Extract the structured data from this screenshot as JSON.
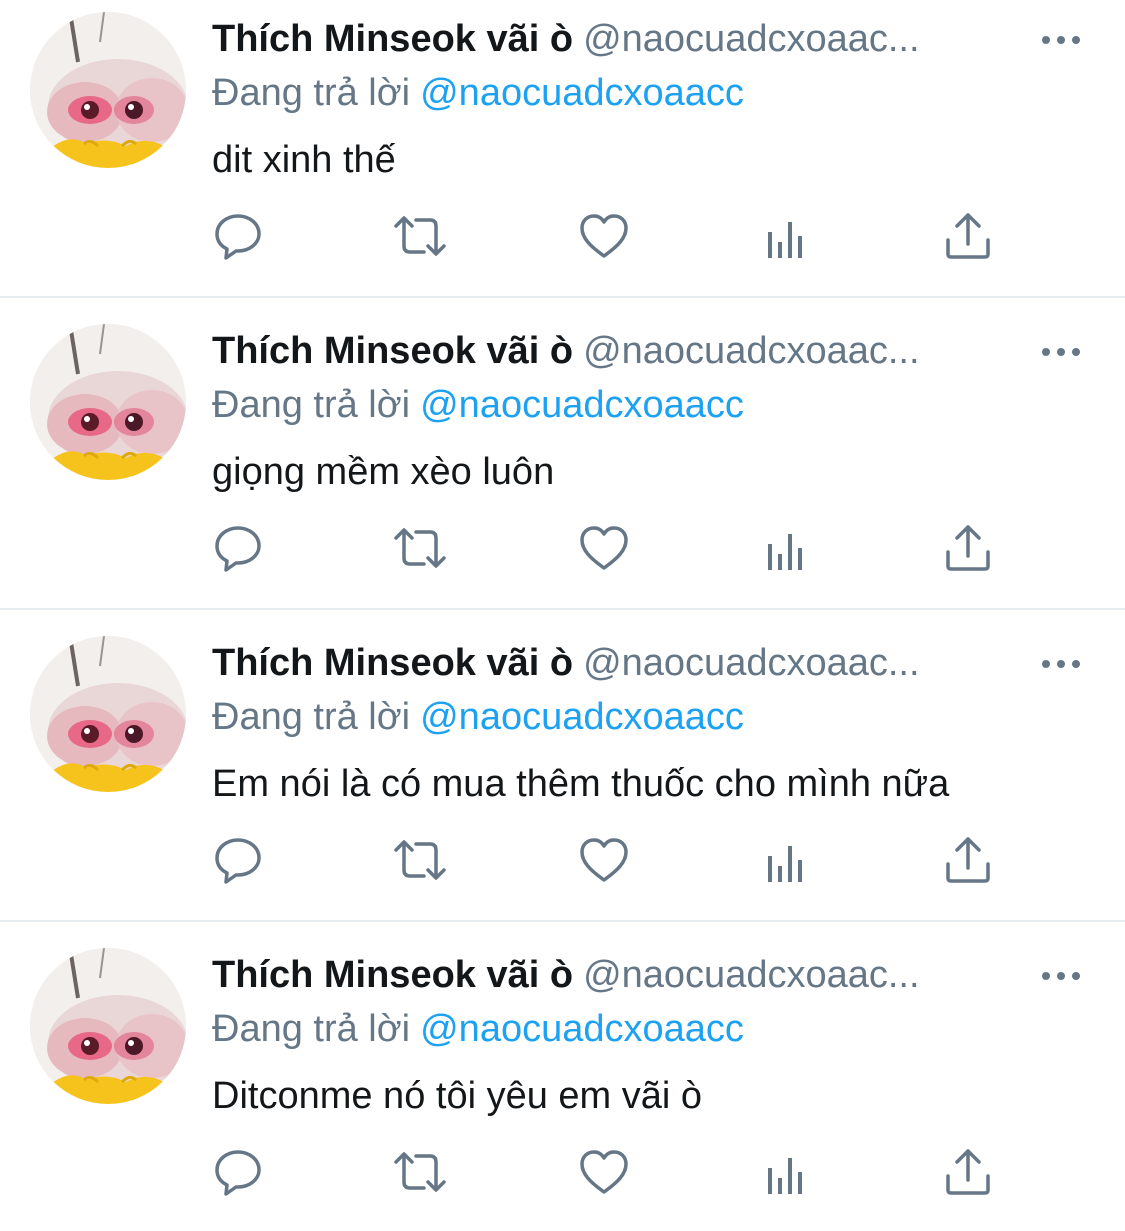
{
  "colors": {
    "name": "#14171a",
    "secondary": "#657786",
    "link": "#1da1f2",
    "divider": "#e6ecf0",
    "icon": "#657786"
  },
  "icons": {
    "reply": "speech-bubble-icon",
    "retweet": "retweet-arrows-icon",
    "like": "heart-icon",
    "analytics": "bar-chart-icon",
    "share": "share-upload-icon",
    "more": "ellipsis-icon"
  },
  "tweets": [
    {
      "display_name": "Thích Minseok vãi ò",
      "handle": "@naocuadcxoaac...",
      "reply_prefix": "Đang trả lời",
      "reply_to": "@naocuadcxoaacc",
      "text": "dit xinh thế"
    },
    {
      "display_name": "Thích Minseok vãi ò",
      "handle": "@naocuadcxoaac...",
      "reply_prefix": "Đang trả lời",
      "reply_to": "@naocuadcxoaacc",
      "text": "giọng mềm xèo luôn"
    },
    {
      "display_name": "Thích Minseok vãi ò",
      "handle": "@naocuadcxoaac...",
      "reply_prefix": "Đang trả lời",
      "reply_to": "@naocuadcxoaacc",
      "text": "Em nói là có mua thêm thuốc cho mình nữa"
    },
    {
      "display_name": "Thích Minseok vãi ò",
      "handle": "@naocuadcxoaac...",
      "reply_prefix": "Đang trả lời",
      "reply_to": "@naocuadcxoaacc",
      "text": "Ditconme nó tôi yêu em vãi ò"
    }
  ]
}
